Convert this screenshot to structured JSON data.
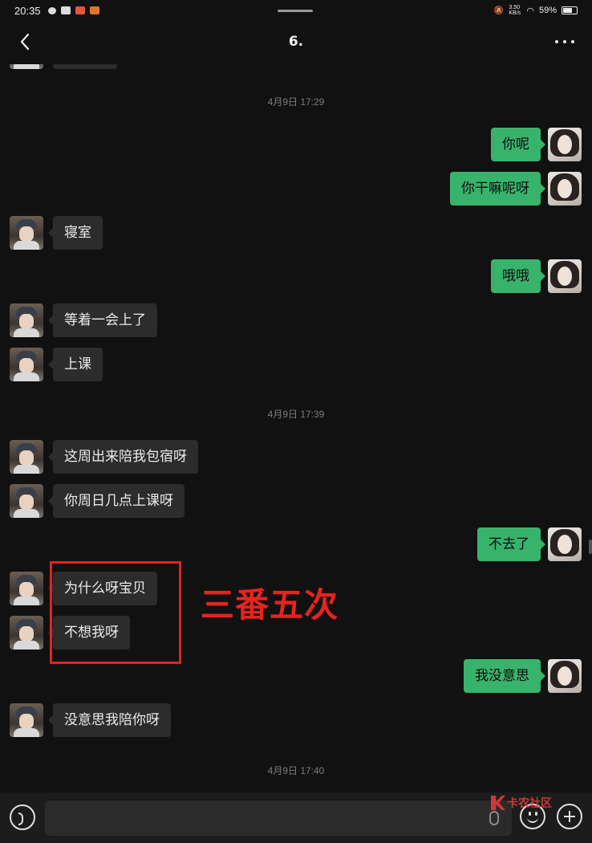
{
  "status_bar": {
    "time": "20:35",
    "speed": "3.50 KB/s",
    "battery": "59%"
  },
  "header": {
    "title": "6."
  },
  "timestamps": [
    "4月9日 17:29",
    "4月9日 17:39",
    "4月9日 17:40"
  ],
  "messages": [
    {
      "side": "out",
      "text": "你呢"
    },
    {
      "side": "out",
      "text": "你干嘛呢呀"
    },
    {
      "side": "in",
      "text": "寝室"
    },
    {
      "side": "out",
      "text": "哦哦"
    },
    {
      "side": "in",
      "text": "等着一会上了"
    },
    {
      "side": "in",
      "text": "上课"
    },
    {
      "side": "in",
      "text": "这周出来陪我包宿呀"
    },
    {
      "side": "in",
      "text": "你周日几点上课呀"
    },
    {
      "side": "out",
      "text": "不去了"
    },
    {
      "side": "in",
      "text": "为什么呀宝贝"
    },
    {
      "side": "in",
      "text": "不想我呀"
    },
    {
      "side": "out",
      "text": "我没意思"
    },
    {
      "side": "in",
      "text": "没意思我陪你呀"
    }
  ],
  "annotation": {
    "text": "三番五次",
    "color": "#e8231f"
  },
  "input_bar": {
    "placeholder": ""
  },
  "watermark": {
    "text": "卡农社区"
  },
  "icons": {
    "back": "chevron-left-icon",
    "more": "more-dots-icon",
    "voice": "voice-icon",
    "mic": "mic-icon",
    "emoji": "emoji-icon",
    "plus": "plus-icon"
  },
  "colors": {
    "background": "#111111",
    "incoming_bubble": "#2c2c2c",
    "outgoing_bubble": "#38b36c"
  }
}
